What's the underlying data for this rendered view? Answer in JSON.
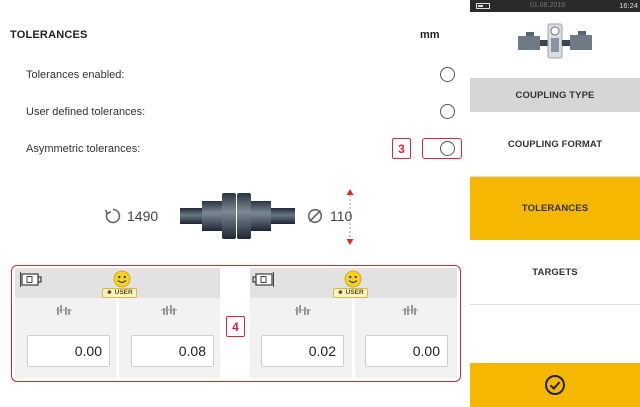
{
  "header": {
    "title": "TOLERANCES",
    "unit": "mm"
  },
  "settings": [
    {
      "label": "Tolerances enabled:"
    },
    {
      "label": "User defined tolerances:"
    },
    {
      "label": "Asymmetric tolerances:"
    }
  ],
  "callouts": {
    "asymmetric": "3",
    "panels": "4"
  },
  "coupling": {
    "speed": "1490",
    "diameter": "110"
  },
  "panels": {
    "left": {
      "badge": "USER",
      "values": [
        "0.00",
        "0.08"
      ]
    },
    "right": {
      "badge": "USER",
      "values": [
        "0.02",
        "0.00"
      ]
    }
  },
  "sidebar": {
    "status_time": "16:24",
    "status_faded": "01.08.2019",
    "items": [
      {
        "label": "COUPLING TYPE"
      },
      {
        "label": "COUPLING FORMAT"
      },
      {
        "label": "TOLERANCES"
      },
      {
        "label": "TARGETS"
      }
    ]
  },
  "colors": {
    "accent": "#f5b700",
    "callout": "#d8283a",
    "grey_item": "#d6d6d6"
  }
}
